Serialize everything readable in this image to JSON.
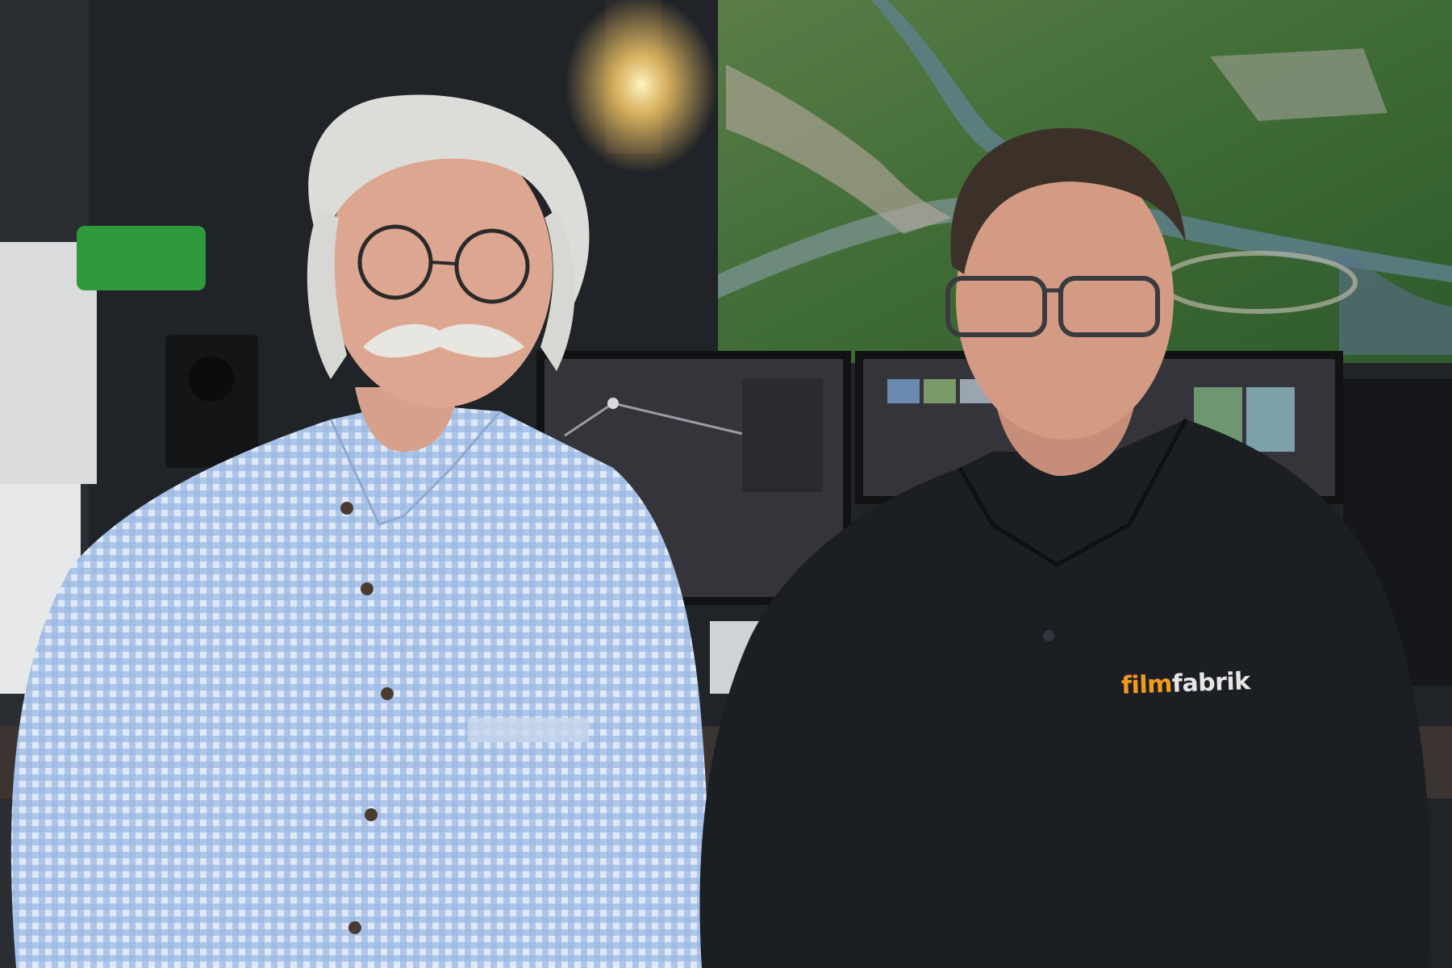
{
  "scene": {
    "shirt_logo": {
      "part1": "film",
      "part2": "fabrik"
    },
    "colors": {
      "logo_orange": "#f39a1e",
      "logo_white": "#e6e6e6",
      "shirt_black": "#1b1e23",
      "check_shirt_blue": "#8fb0dc",
      "monitor_screen": "#34343a",
      "wall_dark": "#202327",
      "landscape_green": "#3f6b35"
    }
  }
}
